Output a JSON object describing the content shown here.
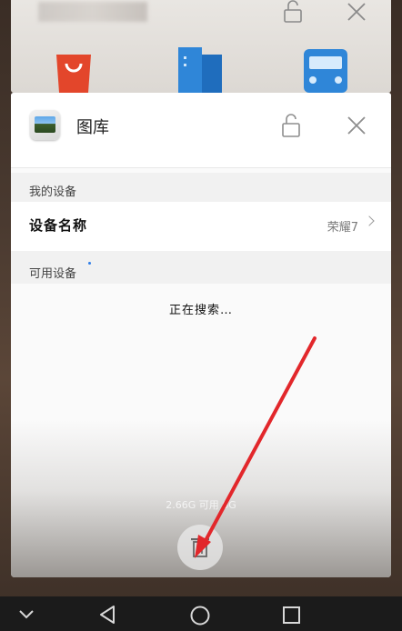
{
  "background_card": {
    "title_blurred": "",
    "icons": [
      "shopping-bag-icon",
      "building-icon",
      "car-icon"
    ]
  },
  "recent_card": {
    "app_name": "图库",
    "sections": [
      {
        "header": "我的设备"
      },
      {
        "header": "可用设备"
      }
    ],
    "device_row": {
      "label": "设备名称",
      "value": "荣耀7"
    },
    "searching_text": "正在搜索…"
  },
  "memory_status": "2.66G 可用 6G",
  "nav": [
    "back-icon",
    "home-icon",
    "recents-icon",
    "collapse-icon"
  ],
  "colors": {
    "accent_blue": "#2f7ee8",
    "annotation_red": "#e2272b"
  }
}
